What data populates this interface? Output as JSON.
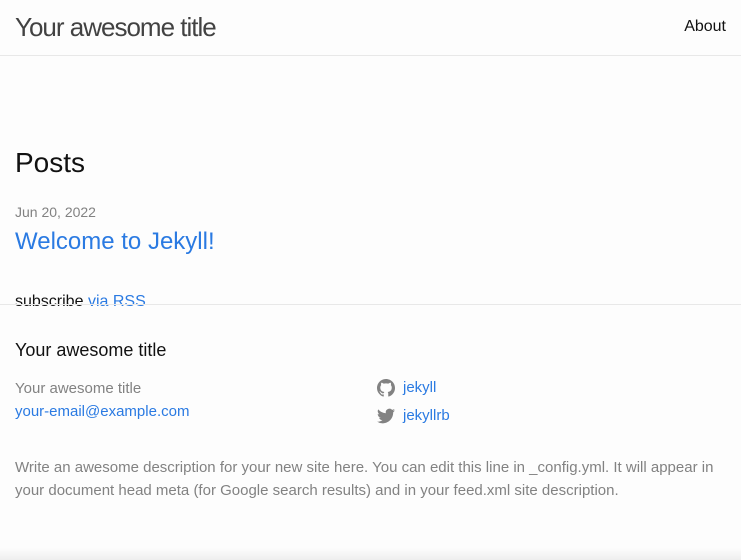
{
  "header": {
    "site_title": "Your awesome title",
    "nav": [
      {
        "label": "About"
      }
    ]
  },
  "main": {
    "heading": "Posts",
    "posts": [
      {
        "date": "Jun 20, 2022",
        "title": "Welcome to Jekyll!"
      }
    ],
    "rss": {
      "prefix": "subscribe",
      "link_label": "via RSS"
    }
  },
  "footer": {
    "heading": "Your awesome title",
    "col1_title": "Your awesome title",
    "email": "your-email@example.com",
    "social": [
      {
        "icon": "github-icon",
        "label": "jekyll"
      },
      {
        "icon": "twitter-icon",
        "label": "jekyllrb"
      }
    ],
    "description": "Write an awesome description for your new site here. You can edit this line in _config.yml. It will appear in your document head meta (for Google search results) and in your feed.xml site description."
  },
  "colors": {
    "link": "#2a7ae2",
    "muted": "#828282",
    "text": "#111111",
    "border": "#e8e8e8"
  }
}
